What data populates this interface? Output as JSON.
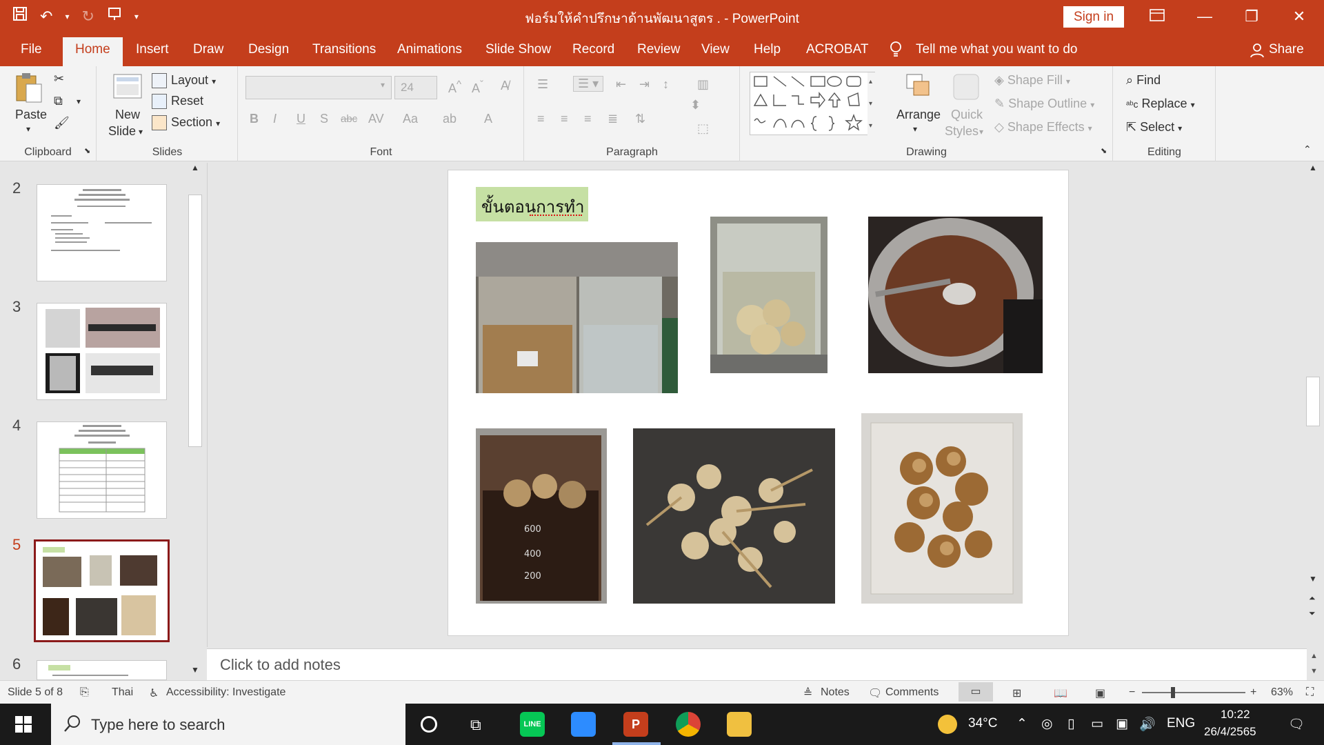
{
  "title_bar": {
    "doc_title": "ฟอร์มให้คำปรึกษาด้านพัฒนาสูตร .  -  PowerPoint",
    "sign_in": "Sign in"
  },
  "tabs": [
    "File",
    "Home",
    "Insert",
    "Draw",
    "Design",
    "Transitions",
    "Animations",
    "Slide Show",
    "Record",
    "Review",
    "View",
    "Help",
    "ACROBAT"
  ],
  "active_tab": "Home",
  "tell_me": "Tell me what you want to do",
  "share": "Share",
  "ribbon": {
    "clipboard": {
      "paste": "Paste",
      "label": "Clipboard"
    },
    "slides": {
      "new_slide_1": "New",
      "new_slide_2": "Slide",
      "layout": "Layout",
      "reset": "Reset",
      "section": "Section",
      "label": "Slides"
    },
    "font": {
      "size": "24",
      "label": "Font"
    },
    "paragraph": {
      "label": "Paragraph"
    },
    "drawing": {
      "arrange": "Arrange",
      "quick_1": "Quick",
      "quick_2": "Styles",
      "shape_fill": "Shape Fill",
      "shape_outline": "Shape Outline",
      "shape_effects": "Shape Effects",
      "label": "Drawing"
    },
    "editing": {
      "find": "Find",
      "replace": "Replace",
      "select": "Select",
      "label": "Editing"
    }
  },
  "thumbnails": [
    {
      "num": "2",
      "active": false
    },
    {
      "num": "3",
      "active": false
    },
    {
      "num": "4",
      "active": false
    },
    {
      "num": "5",
      "active": true
    },
    {
      "num": "6",
      "active": false
    }
  ],
  "slide": {
    "heading": "ขั้นตอนการทำ"
  },
  "notes_placeholder": "Click to add notes",
  "status": {
    "slide_of": "Slide 5 of 8",
    "language": "Thai",
    "accessibility": "Accessibility: Investigate",
    "notes": "Notes",
    "comments": "Comments",
    "zoom": "63%"
  },
  "taskbar": {
    "search_placeholder": "Type here to search",
    "temp": "34°C",
    "lang": "ENG",
    "time": "10:22",
    "date": "26/4/2565"
  },
  "colors": {
    "accent": "#c43e1c",
    "heading_bg": "#c6e0a4",
    "active_thumb_border": "#8b1a1a"
  }
}
